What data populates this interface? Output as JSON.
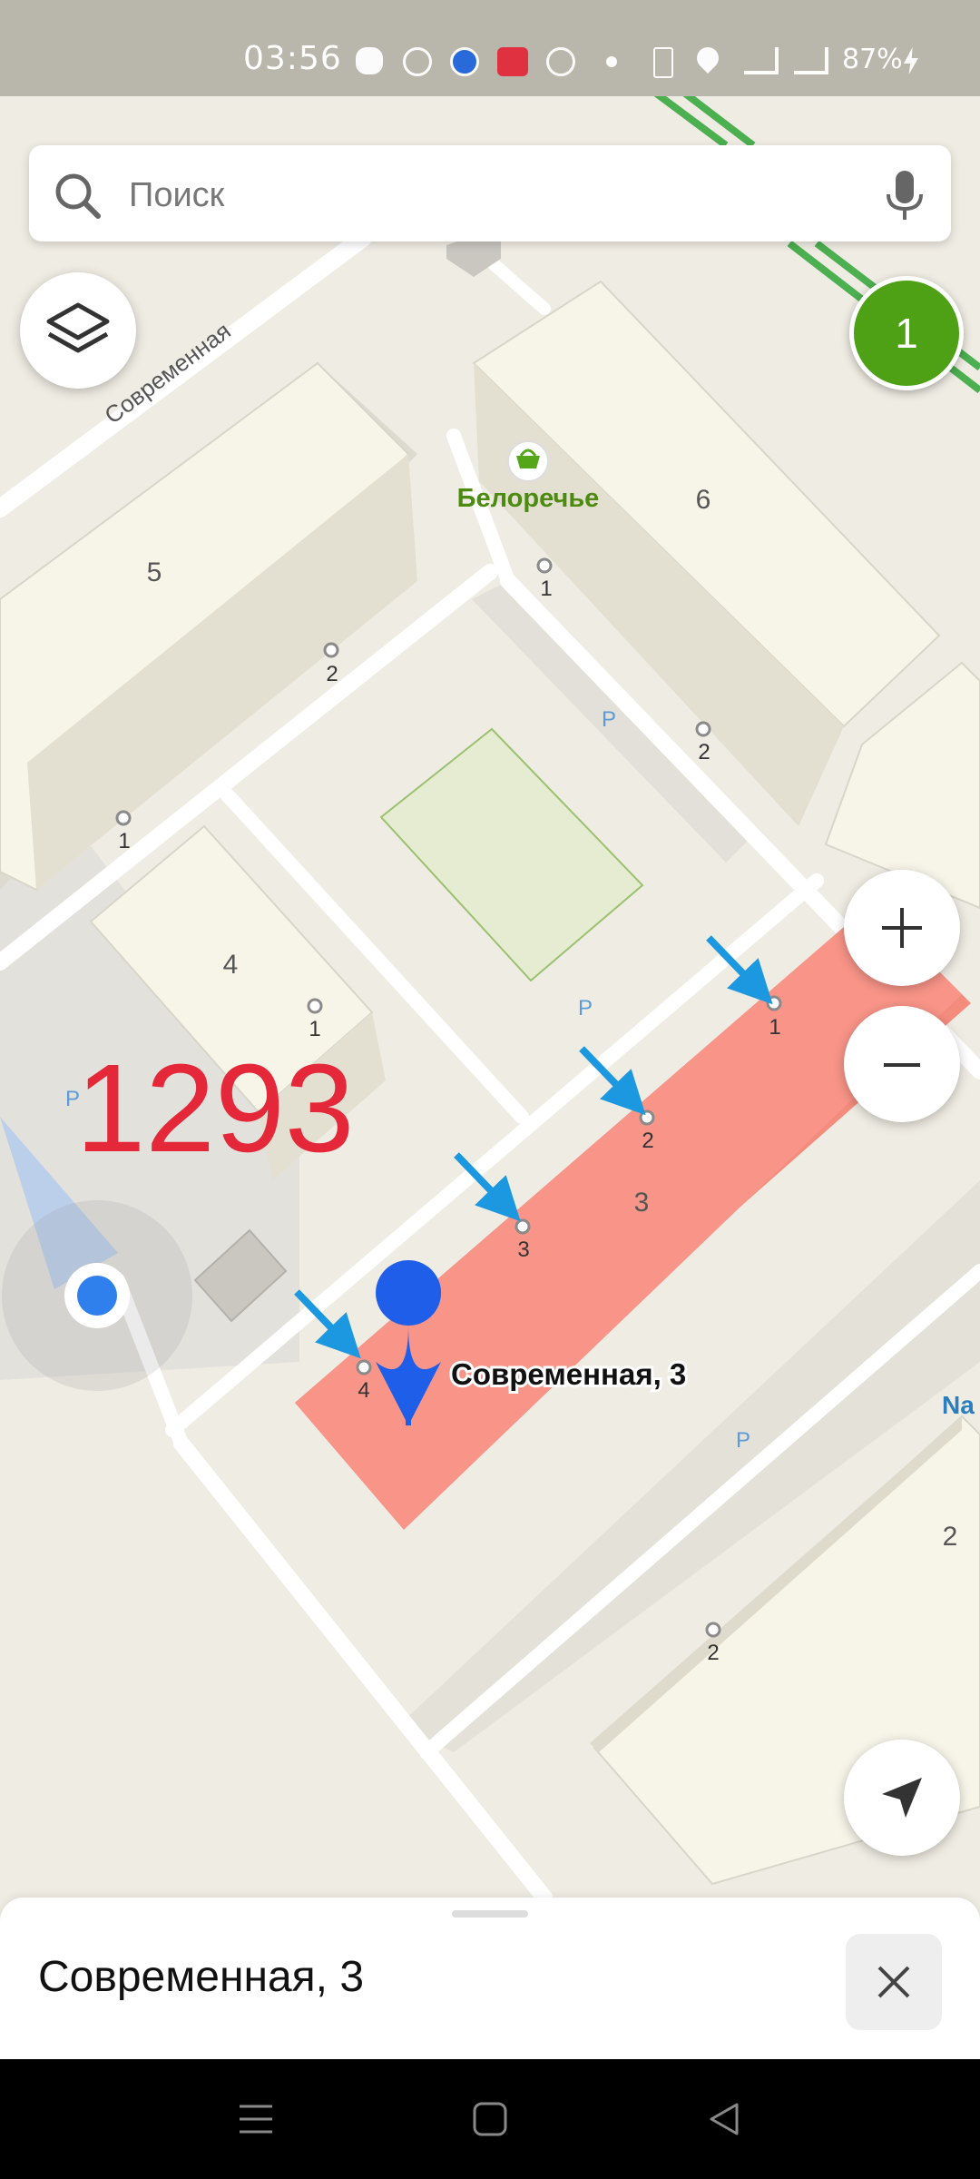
{
  "status_bar": {
    "time": "03:56",
    "battery": "87%"
  },
  "search": {
    "placeholder": "Поиск"
  },
  "badge": {
    "count": "1"
  },
  "map": {
    "street_label": "Современная",
    "poi": {
      "name": "Белоречье"
    },
    "overlay_number": "1293",
    "parking_label": "P",
    "building_numbers": [
      "5",
      "6",
      "4",
      "3",
      "2"
    ],
    "entrance_numbers": [
      "1",
      "2",
      "3",
      "4"
    ],
    "selected_address": "Современная, 3",
    "partial_label": "Na",
    "colors": {
      "highlight": "#f89488",
      "pin": "#1f5ee8",
      "arrow": "#1b98e0",
      "overlay_text": "#e4283a",
      "poi_text": "#4d8a10"
    }
  },
  "bottom_sheet": {
    "title": "Современная, 3"
  }
}
